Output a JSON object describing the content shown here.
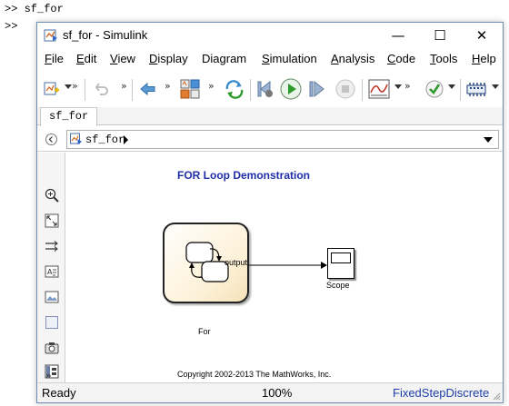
{
  "command_window": {
    "lines": [
      ">> sf_for",
      ">>"
    ]
  },
  "window": {
    "title": "sf_for - Simulink",
    "controls": {
      "minimize": "—",
      "maximize": "☐",
      "close": "✕"
    }
  },
  "menu": {
    "items": [
      {
        "key": "file",
        "label": "File",
        "access": "F",
        "rest": "ile"
      },
      {
        "key": "edit",
        "label": "Edit",
        "access": "E",
        "rest": "dit"
      },
      {
        "key": "view",
        "label": "View",
        "access": "V",
        "rest": "iew"
      },
      {
        "key": "display",
        "label": "Display",
        "access": "D",
        "rest": "isplay"
      },
      {
        "key": "diagram",
        "label": "Diagram",
        "access": "",
        "rest": "Diagram"
      },
      {
        "key": "simulation",
        "label": "Simulation",
        "access": "S",
        "rest": "imulation"
      },
      {
        "key": "analysis",
        "label": "Analysis",
        "access": "A",
        "rest": "nalysis"
      },
      {
        "key": "code",
        "label": "Code",
        "access": "C",
        "rest": "ode"
      },
      {
        "key": "tools",
        "label": "Tools",
        "access": "T",
        "rest": "ools"
      },
      {
        "key": "help",
        "label": "Help",
        "access": "H",
        "rest": "elp"
      }
    ]
  },
  "toolbar": {
    "more_glyph": "»"
  },
  "tabs": {
    "active": "sf_for"
  },
  "address": {
    "path": "sf_for"
  },
  "palette": {
    "more_glyph": "»"
  },
  "diagram": {
    "title": "FOR Loop Demonstration",
    "chart_block": {
      "name": "For",
      "output_port": "output"
    },
    "scope_block": {
      "name": "Scope"
    },
    "copyright": "Copyright 2002-2013 The MathWorks, Inc."
  },
  "status": {
    "state": "Ready",
    "zoom": "100%",
    "solver": "FixedStepDiscrete"
  },
  "colors": {
    "title_blue": "#1f2ea8",
    "solver_blue": "#1d3fa8",
    "run_green": "#2e9a2e",
    "chart_fill": "#fdf3dc"
  }
}
